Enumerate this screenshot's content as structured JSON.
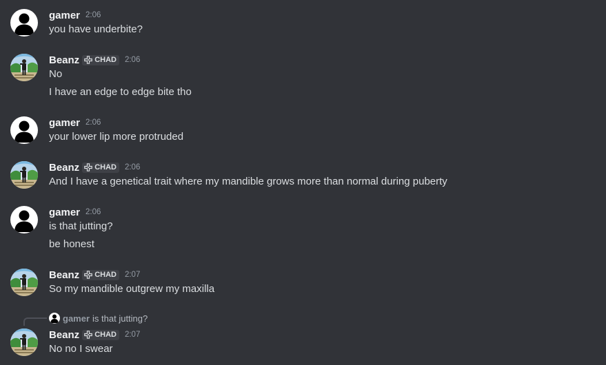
{
  "users": {
    "gamer": {
      "name": "gamer",
      "avatar": "default-silhouette-avatar"
    },
    "beanz": {
      "name": "Beanz",
      "tag": "CHAD",
      "tag_icon": "dpad-icon",
      "avatar": "photo-avatar"
    }
  },
  "messages": [
    {
      "author": "gamer",
      "time": "2:06",
      "lines": [
        "you have underbite?"
      ]
    },
    {
      "author": "Beanz",
      "tag": "CHAD",
      "time": "2:06",
      "lines": [
        "No",
        "I have an edge to edge bite tho"
      ]
    },
    {
      "author": "gamer",
      "time": "2:06",
      "lines": [
        "your lower lip more protruded"
      ]
    },
    {
      "author": "Beanz",
      "tag": "CHAD",
      "time": "2:06",
      "lines": [
        "And I have a genetical trait where my mandible grows more than normal during puberty"
      ]
    },
    {
      "author": "gamer",
      "time": "2:06",
      "lines": [
        "is that jutting?",
        "be honest"
      ]
    },
    {
      "author": "Beanz",
      "tag": "CHAD",
      "time": "2:07",
      "lines": [
        "So my mandible outgrew my maxilla"
      ]
    },
    {
      "author": "Beanz",
      "tag": "CHAD",
      "time": "2:07",
      "reply": {
        "author": "gamer",
        "text": "is that jutting?"
      },
      "lines": [
        "No no I swear"
      ]
    }
  ],
  "colors": {
    "background": "#313338",
    "username": "#f2f3f5",
    "text": "#dbdee1",
    "timestamp": "#949ba4",
    "tag_background": "#3f4147"
  }
}
